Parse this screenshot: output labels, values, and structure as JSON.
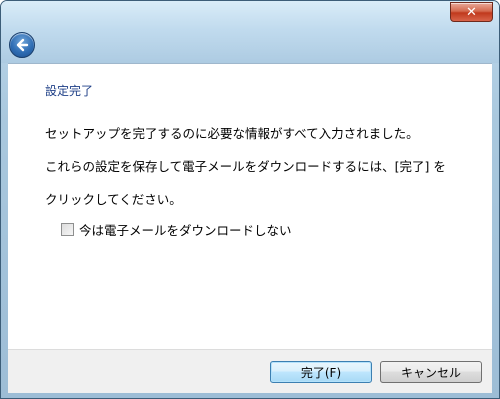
{
  "window": {
    "close_symbol": "✕"
  },
  "nav": {
    "back_icon": "back-arrow-icon"
  },
  "main": {
    "heading": "設定完了",
    "line1": "セットアップを完了するのに必要な情報がすべて入力されました。",
    "line2": "これらの設定を保存して電子メールをダウンロードするには、[完了] を",
    "line3": "クリックしてください。",
    "checkbox_label": "今は電子メールをダウンロードしない",
    "checkbox_checked": false
  },
  "footer": {
    "finish_label": "完了(F)",
    "cancel_label": "キャンセル"
  },
  "colors": {
    "heading": "#1e3f87",
    "close_button": "#c0391d",
    "back_button": "#2f6db4"
  }
}
